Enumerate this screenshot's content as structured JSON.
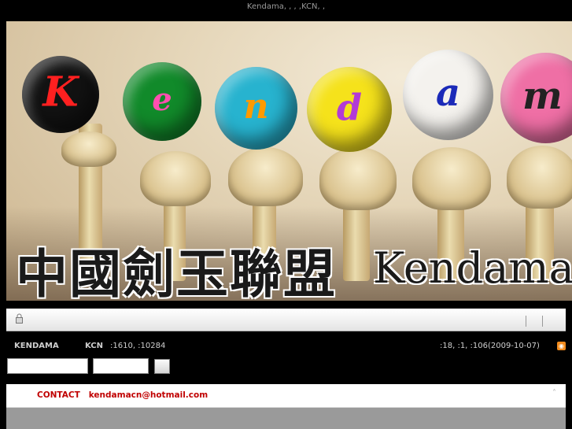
{
  "header": {
    "tagline": "Kendama, , ,       ,KCN, ,"
  },
  "banner": {
    "letters": [
      "K",
      "e",
      "n",
      "d",
      "a",
      "m"
    ],
    "colors": {
      "ball1": "#121212",
      "ball2": "#118a2a",
      "ball3": "#27b3cf",
      "ball4": "#f5e21b",
      "ball5": "#f4f2ee",
      "ball6": "#ef6fa5",
      "letter1": "#ff2020",
      "letter2": "#ff4fb0",
      "letter3": "#ff9a00",
      "letter4": "#b23bd6",
      "letter5": "#1b2ab8",
      "letter6": "#222222"
    },
    "title_cn": "中國劍玉聯盟",
    "domain": "Kendamacn.c"
  },
  "infobar": {
    "left_label": "KENDAMA",
    "stats_label": "KCN",
    "stats_value": ":1610,  :10284",
    "right_stats": ":18,  :1,   :106(2009-10-07)"
  },
  "contact": {
    "label": "CONTACT",
    "email": "kendamacn@hotmail.com"
  }
}
